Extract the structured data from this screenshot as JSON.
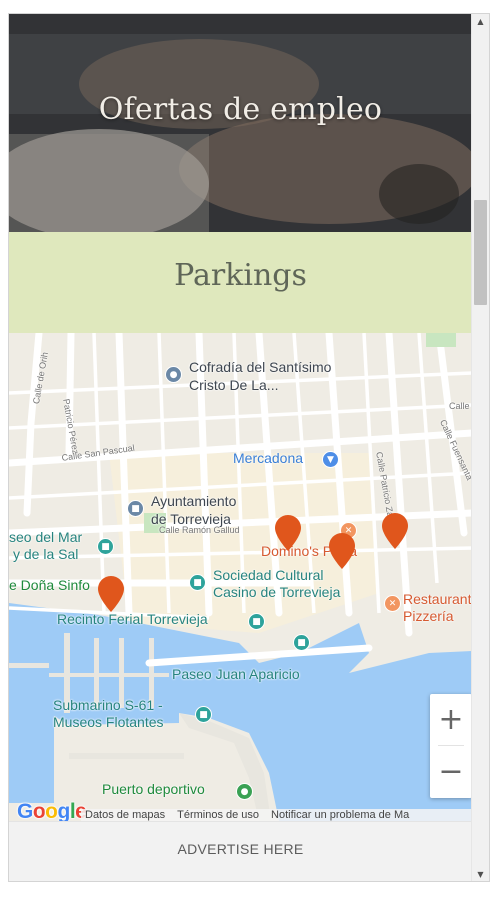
{
  "hero": {
    "title": "Ofertas de empleo"
  },
  "parkings": {
    "title": "Parkings"
  },
  "map": {
    "streets": {
      "calle_de_orihuela": "Calle de Orih",
      "patricio_perez": "Patricio Pérez",
      "calle_san_pascual": "Calle San Pascual",
      "calle_ramon_gallud": "Calle Ramón Gallud",
      "calle_partricio": "Calle Patricio Zammit",
      "calle_fuensanta": "Calle Fuensanta",
      "calle_right": "Calle"
    },
    "places": {
      "cofradia": "Cofradía del Santísimo",
      "cofradia_line2": "Cristo De La...",
      "mercadona": "Mercadona",
      "ayuntamiento": "Ayuntamiento",
      "ayuntamiento_line2": "de Torrevieja",
      "museo_mar": "seo del Mar",
      "museo_mar_line2": "y de la Sal",
      "dominos": "Domino's Pizza",
      "sociedad": "Sociedad Cultural",
      "sociedad_line2": "Casino de Torrevieja",
      "dona_sinfo": "e Doña Sinfo",
      "recinto": "Recinto Ferial Torrevieja",
      "restaurant": "Restaurante",
      "restaurant_line2": "Pizzería",
      "paseo": "Paseo Juan Aparicio",
      "submarino": "Submarino S-61 -",
      "submarino_line2": "Museos Flotantes",
      "puerto": "Puerto deportivo"
    },
    "zoom": {
      "in": "+",
      "out": "−"
    },
    "google_logo": "Google",
    "attribution": {
      "map_data": "Datos de mapas",
      "terms": "Términos de uso",
      "report": "Notificar un problema de Ma"
    },
    "colors": {
      "water": "#9ecbf6",
      "land": "#efece4",
      "road": "#ffffff",
      "pin": "#e0561c"
    }
  },
  "advertise": {
    "label": "ADVERTISE HERE"
  },
  "scrollbar": {
    "up": "▲",
    "down": "▼"
  }
}
